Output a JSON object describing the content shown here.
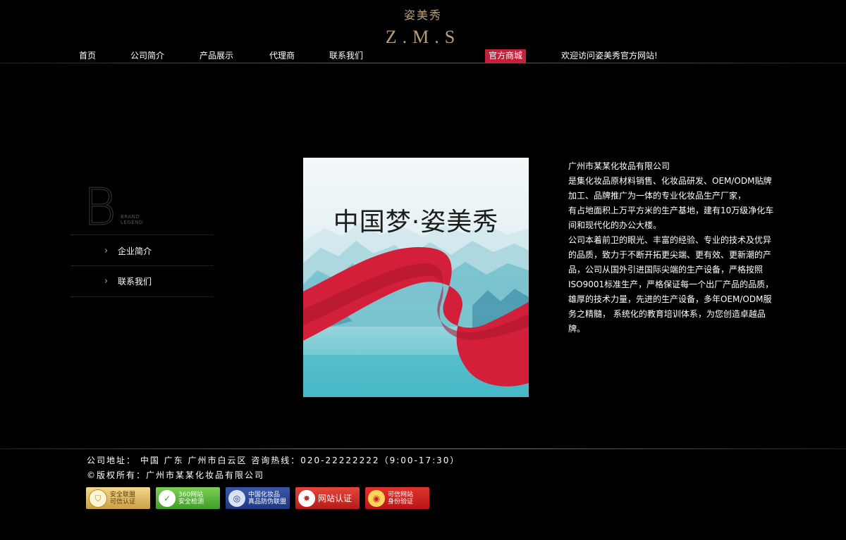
{
  "header": {
    "logo_cn": "姿美秀",
    "logo_en": "Z.M.S"
  },
  "nav": {
    "items": [
      {
        "label": "首页"
      },
      {
        "label": "公司简介"
      },
      {
        "label": "产品展示"
      },
      {
        "label": "代理商"
      },
      {
        "label": "联系我们"
      }
    ],
    "mall_label": "官方商城",
    "welcome": "欢迎访问姿美秀官方网站!"
  },
  "sidebar": {
    "letter": "B",
    "brand_text": "BRAND\nLEGEND",
    "items": [
      {
        "label": "企业简介"
      },
      {
        "label": "联系我们"
      }
    ]
  },
  "poster": {
    "title": "中国梦·姿美秀",
    "colors": {
      "ribbon": "#d41f3a",
      "sky": "#e7f2f4",
      "water": "#4bbcc8"
    }
  },
  "description": {
    "lines": [
      "广州市某某化妆品有限公司",
      "是集化妆品原材料销售、化妆品研发、OEM/ODM贴牌加工、品牌推广为一体的专业化妆品生产厂家，",
      "有占地面积上万平方米的生产基地，建有10万级净化车间和现代化的办公大楼。",
      "公司本着前卫的眼光、丰富的经验、专业的技术及优异的品质，致力于不断开拓更尖端、更有效、更新潮的产品，公司从国外引进国际尖端的生产设备，严格按照ISO9001标准生产，严格保证每一个出厂产品的品质，雄厚的技术力量，先进的生产设备，多年OEM/ODM服务之精髓， 系统化的教育培训体系，为您创造卓越品牌。"
    ]
  },
  "footer": {
    "address": "公司地址： 中国 广东 广州市白云区  咨询热线：020-22222222（9:00-17:30）",
    "copyright": "©版权所有：广州市某某化妆品有限公司",
    "badges": [
      {
        "icon": "shield-icon",
        "line1": "安全联盟",
        "line2": "可信认证"
      },
      {
        "icon": "magnifier-icon",
        "line1": "360网站",
        "line2": "安全检测"
      },
      {
        "icon": "globe-icon",
        "line1": "中国化妆品",
        "line2": "真品防伪联盟"
      },
      {
        "icon": "seal-icon",
        "line1": "网站认证",
        "line2": ""
      },
      {
        "icon": "ring-icon",
        "line1": "可信网站",
        "line2": "身份验证"
      }
    ]
  }
}
